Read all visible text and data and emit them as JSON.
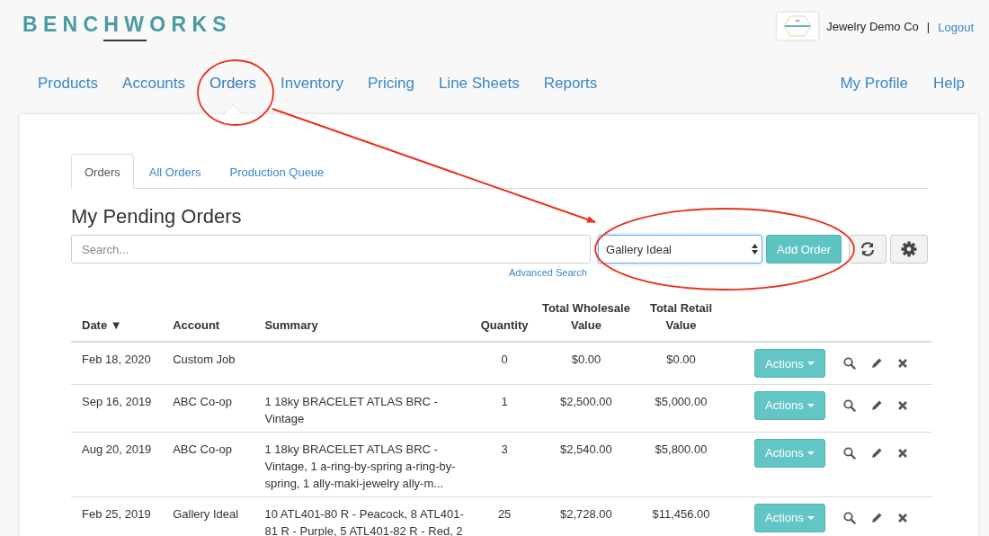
{
  "header": {
    "logo": "BENCHWORKS",
    "company": "Jewelry Demo Co",
    "separator": "|",
    "logout": "Logout"
  },
  "nav": {
    "items": [
      {
        "label": "Products",
        "selected": false
      },
      {
        "label": "Accounts",
        "selected": false
      },
      {
        "label": "Orders",
        "selected": true
      },
      {
        "label": "Inventory",
        "selected": false
      },
      {
        "label": "Pricing",
        "selected": false
      },
      {
        "label": "Line Sheets",
        "selected": false
      },
      {
        "label": "Reports",
        "selected": false
      }
    ],
    "right_items": [
      {
        "label": "My Profile",
        "selected": false
      },
      {
        "label": "Help",
        "selected": false
      }
    ]
  },
  "tabs": [
    {
      "label": "Orders",
      "selected": true
    },
    {
      "label": "All Orders",
      "selected": false
    },
    {
      "label": "Production Queue",
      "selected": false
    }
  ],
  "heading": "My Pending Orders",
  "search": {
    "placeholder": "Search...",
    "advanced_link": "Advanced Search"
  },
  "account_select": {
    "value": "Gallery Ideal"
  },
  "add_order_button": "Add Order",
  "table": {
    "columns": [
      {
        "label": "Date",
        "sort_indicator": "▼"
      },
      {
        "label": "Account"
      },
      {
        "label": "Summary"
      },
      {
        "label": "Quantity"
      },
      {
        "label": "Total Wholesale Value"
      },
      {
        "label": "Total Retail Value"
      }
    ],
    "rows": [
      {
        "date": "Feb 18, 2020",
        "account": "Custom Job",
        "summary": "",
        "quantity": "0",
        "wholesale": "$0.00",
        "retail": "$0.00",
        "action": "Actions"
      },
      {
        "date": "Sep 16, 2019",
        "account": "ABC Co-op",
        "summary": "1 18ky BRACELET ATLAS BRC - Vintage",
        "quantity": "1",
        "wholesale": "$2,500.00",
        "retail": "$5,000.00",
        "action": "Actions"
      },
      {
        "date": "Aug 20, 2019",
        "account": "ABC Co-op",
        "summary": "1 18ky BRACELET ATLAS BRC - Vintage, 1 a-ring-by-spring a-ring-by-spring, 1 ally-maki-jewelry ally-m...",
        "quantity": "3",
        "wholesale": "$2,540.00",
        "retail": "$5,800.00",
        "action": "Actions"
      },
      {
        "date": "Feb 25, 2019",
        "account": "Gallery Ideal",
        "summary": "10 ATL401-80 R - Peacock, 8 ATL401-81 R - Purple, 5 ATL401-82 R - Red, 2",
        "quantity": "25",
        "wholesale": "$2,728.00",
        "retail": "$11,456.00",
        "action": "Actions"
      }
    ]
  }
}
